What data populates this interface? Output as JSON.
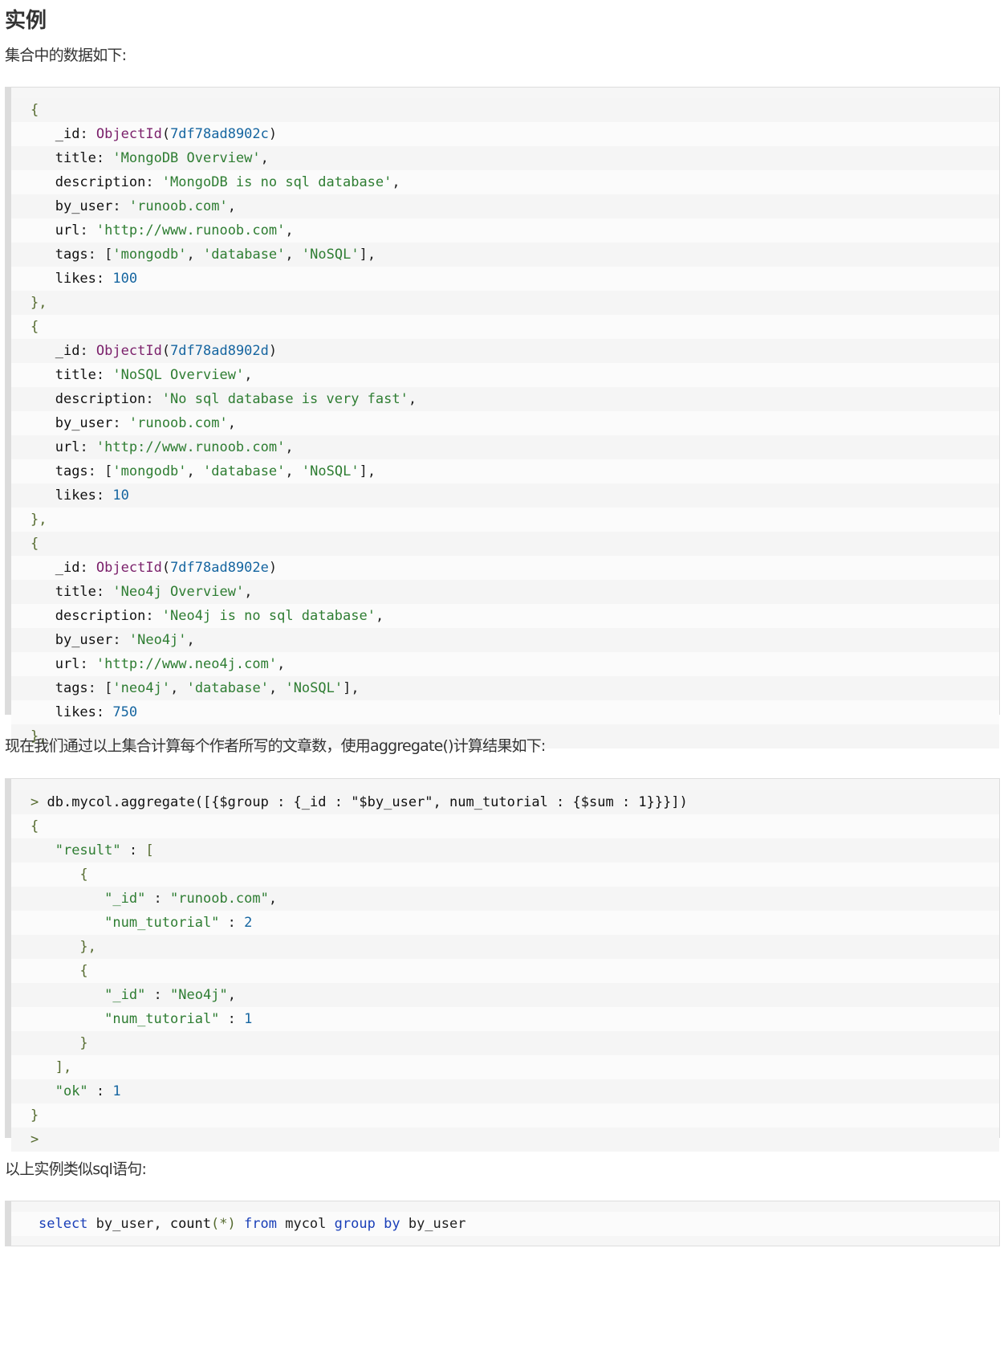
{
  "heading": "实例",
  "intro": "集合中的数据如下:",
  "docs": [
    {
      "id": "7df78ad8902c",
      "title": "MongoDB Overview",
      "description": "MongoDB is no sql database",
      "by_user": "runoob.com",
      "url": "http://www.runoob.com",
      "tags": [
        "mongodb",
        "database",
        "NoSQL"
      ],
      "likes": "100"
    },
    {
      "id": "7df78ad8902d",
      "title": "NoSQL Overview",
      "description": "No sql database is very fast",
      "by_user": "runoob.com",
      "url": "http://www.runoob.com",
      "tags": [
        "mongodb",
        "database",
        "NoSQL"
      ],
      "likes": "10"
    },
    {
      "id": "7df78ad8902e",
      "title": "Neo4j Overview",
      "description": "Neo4j is no sql database",
      "by_user": "Neo4j",
      "url": "http://www.neo4j.com",
      "tags": [
        "neo4j",
        "database",
        "NoSQL"
      ],
      "likes": "750"
    }
  ],
  "middle_text": "现在我们通过以上集合计算每个作者所写的文章数，使用aggregate()计算结果如下:",
  "aggregate": {
    "command_prompt": ">",
    "command": "db.mycol.aggregate([{$group : {_id : \"$by_user\", num_tutorial : {$sum : 1}}}])",
    "results": [
      {
        "id": "runoob.com",
        "num_tutorial": "2"
      },
      {
        "id": "Neo4j",
        "num_tutorial": "1"
      }
    ],
    "ok": "1",
    "end_prompt": ">"
  },
  "sql_intro": "以上实例类似sql语句:",
  "sql": "select by_user, count(*) from mycol group by by_user"
}
